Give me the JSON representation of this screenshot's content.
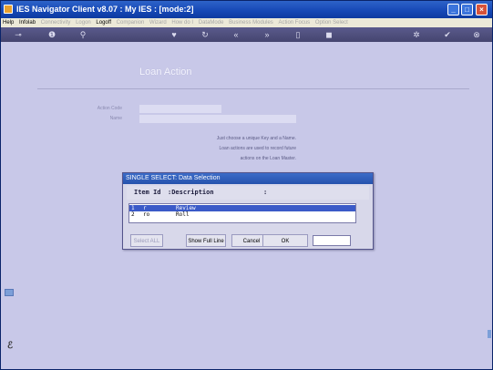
{
  "window": {
    "title": "IES Navigator Client v8.07 : My IES :      [mode:2]",
    "controls": {
      "minimize": "_",
      "maximize": "□",
      "close": "×"
    }
  },
  "menu": [
    {
      "label": "Help",
      "enabled": true
    },
    {
      "label": "Infolab",
      "enabled": true
    },
    {
      "label": "Connectivity",
      "enabled": false
    },
    {
      "label": "Logon",
      "enabled": false
    },
    {
      "label": "Logoff",
      "enabled": true
    },
    {
      "label": "Companion",
      "enabled": false
    },
    {
      "label": "Wizard",
      "enabled": false
    },
    {
      "label": "How do I",
      "enabled": false
    },
    {
      "label": "DataMode",
      "enabled": false
    },
    {
      "label": "Business Modules",
      "enabled": false
    },
    {
      "label": "Action Focus",
      "enabled": false
    },
    {
      "label": "Option Select",
      "enabled": false
    }
  ],
  "toolbar": {
    "icons": [
      "key-icon",
      "info-icon",
      "search-icon",
      "heart-icon",
      "refresh-icon",
      "rewind-icon",
      "fast-forward-icon",
      "document-icon",
      "stop-icon",
      "settings-icon",
      "check-icon",
      "close-icon"
    ],
    "glyphs": [
      "⊸",
      "❶",
      "⚲",
      "♥",
      "↻",
      "«",
      "»",
      "▯",
      "◼",
      "✲",
      "✔",
      "⊗"
    ]
  },
  "form": {
    "title": "Loan Action",
    "fields": [
      {
        "label": "Action Code",
        "value": ""
      },
      {
        "label": "Name",
        "value": ""
      }
    ],
    "help_lines": [
      "Just choose a unique Key and a Name.",
      "Loan actions are used to record future",
      "actions on the Loan Master."
    ]
  },
  "dialog": {
    "title": "SINGLE SELECT: Data Selection",
    "header": {
      "id": "Item Id",
      "desc": ":Description",
      "colon": ":"
    },
    "rows": [
      {
        "num": "1",
        "id": "r",
        "desc": "Review",
        "selected": true
      },
      {
        "num": "2",
        "id": "ro",
        "desc": "Roll",
        "selected": false
      }
    ],
    "buttons": {
      "select_all": "Select ALL",
      "show_full_line": "Show Full Line",
      "cancel": "Cancel",
      "ok": "OK"
    },
    "search_value": ""
  },
  "sidebar": {
    "glyph": "ℰ"
  }
}
